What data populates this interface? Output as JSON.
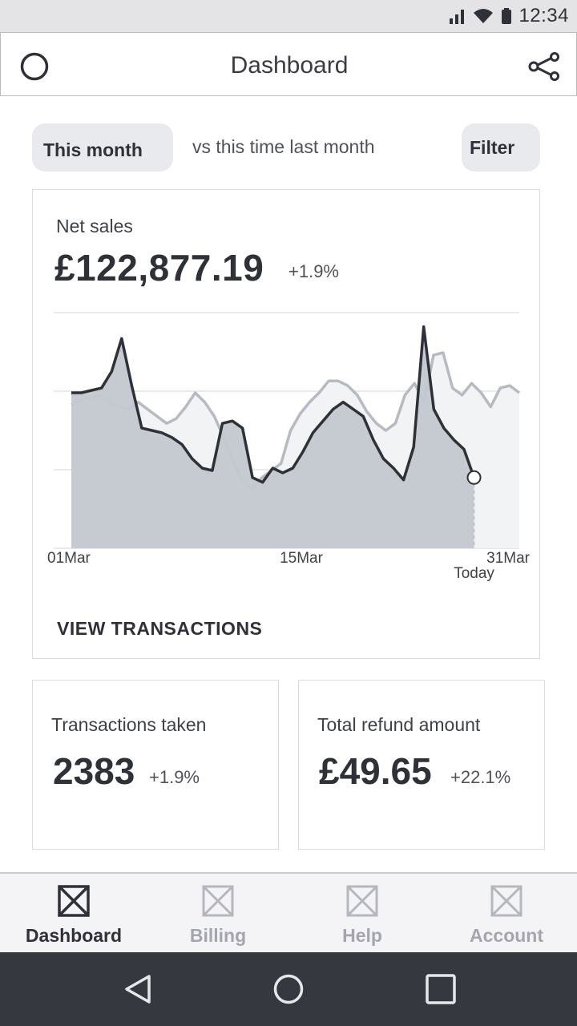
{
  "status": {
    "time": "12:34"
  },
  "appbar": {
    "title": "Dashboard"
  },
  "period": {
    "selected": "This month",
    "comparison": "vs this time last month",
    "filter_label": "Filter"
  },
  "net_sales": {
    "label": "Net sales",
    "value": "£122,877.19",
    "delta": "+1.9%",
    "action": "VIEW TRANSACTIONS"
  },
  "chart_data": {
    "type": "area",
    "x_tick_labels": [
      "01Mar",
      "15Mar",
      "31Mar"
    ],
    "today_label": "Today",
    "series": [
      {
        "values": [
          0.66,
          0.66,
          0.67,
          0.68,
          0.75,
          0.89,
          0.69,
          0.51,
          0.5,
          0.49,
          0.47,
          0.44,
          0.38,
          0.34,
          0.33,
          0.53,
          0.54,
          0.51,
          0.3,
          0.28,
          0.34,
          0.32,
          0.34,
          0.41,
          0.49,
          0.54,
          0.59,
          0.62,
          0.59,
          0.56,
          0.46,
          0.38,
          0.34,
          0.29,
          0.43,
          0.94,
          0.59,
          0.51,
          0.46,
          0.42,
          0.3
        ]
      },
      {
        "values": [
          0.61,
          0.63,
          0.64,
          0.65,
          0.62,
          0.6,
          0.59,
          0.62,
          0.59,
          0.56,
          0.53,
          0.55,
          0.6,
          0.66,
          0.62,
          0.56,
          0.47,
          0.37,
          0.28,
          0.25,
          0.3,
          0.33,
          0.36,
          0.5,
          0.57,
          0.62,
          0.66,
          0.71,
          0.71,
          0.69,
          0.65,
          0.58,
          0.53,
          0.5,
          0.53,
          0.65,
          0.7,
          0.62,
          0.82,
          0.83,
          0.68,
          0.65,
          0.7,
          0.66,
          0.6,
          0.68,
          0.69,
          0.66
        ]
      }
    ],
    "today_fraction": 0.899,
    "grid": true
  },
  "transactions": {
    "label": "Transactions taken",
    "value": "2383",
    "delta": "+1.9%"
  },
  "refunds": {
    "label": "Total refund amount",
    "value": "£49.65",
    "delta": "+22.1%"
  },
  "nav": {
    "items": [
      {
        "label": "Dashboard",
        "icon": "placeholder-icon",
        "active": true
      },
      {
        "label": "Billing",
        "icon": "placeholder-icon",
        "active": false
      },
      {
        "label": "Help",
        "icon": "placeholder-icon",
        "active": false
      },
      {
        "label": "Account",
        "icon": "placeholder-icon",
        "active": false
      }
    ]
  },
  "colors": {
    "accent": "#2f3138",
    "inactive": "#a3a6ad",
    "area_current": "#c3c8d0",
    "area_previous": "#f2f3f5",
    "line_previous": "#b6bac2"
  }
}
